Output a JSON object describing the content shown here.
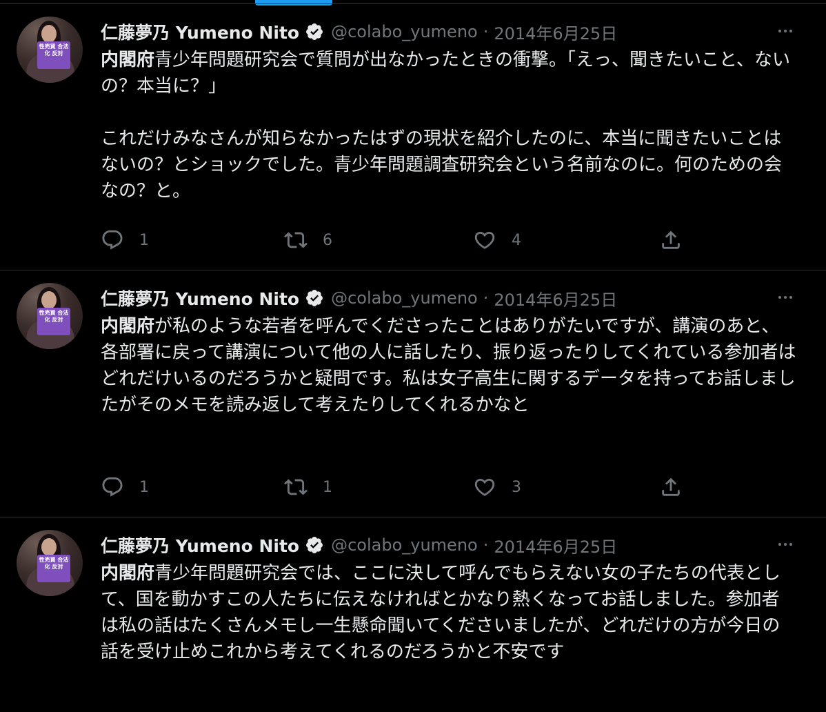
{
  "colors": {
    "background": "#000000",
    "text_primary": "#e7e9ea",
    "text_secondary": "#71767b",
    "divider": "#2f3336",
    "accent": "#1d9bf0",
    "avatar_sign": "#7e4fbd"
  },
  "tweets": [
    {
      "author": {
        "name": "仁藤夢乃 Yumeno Nito",
        "handle": "@colabo_yumeno",
        "verified_icon": "verified-badge-icon",
        "avatar_sign_text": "性売買 合法化 反対"
      },
      "separator": "·",
      "date": "2014年6月25日",
      "more_icon": "more-icon",
      "text": {
        "bold_prefix": "内閣府",
        "paragraph1_rest": "青少年問題研究会で質問が出なかったときの衝撃。「えっ、聞きたいこと、ないの？本当に？」",
        "paragraph2": "これだけみなさんが知らなかったはずの現状を紹介したのに、本当に聞きたいことはないの？とショックでした。青少年問題調査研究会という名前なのに。何のための会なの？と。"
      },
      "actions": {
        "reply_count": "1",
        "retweet_count": "6",
        "like_count": "4"
      }
    },
    {
      "author": {
        "name": "仁藤夢乃 Yumeno Nito",
        "handle": "@colabo_yumeno",
        "verified_icon": "verified-badge-icon",
        "avatar_sign_text": "性売買 合法化 反対"
      },
      "separator": "·",
      "date": "2014年6月25日",
      "more_icon": "more-icon",
      "text": {
        "bold_prefix": "内閣府",
        "paragraph1_rest": "が私のような若者を呼んでくださったことはありがたいですが、講演のあと、各部署に戻って講演について他の人に話したり、振り返ったりしてくれている参加者はどれだけいるのだろうかと疑問です。私は女子高生に関するデータを持ってお話しましたがそのメモを読み返して考えたりしてくれるかなと"
      },
      "actions": {
        "reply_count": "1",
        "retweet_count": "1",
        "like_count": "3"
      }
    },
    {
      "author": {
        "name": "仁藤夢乃 Yumeno Nito",
        "handle": "@colabo_yumeno",
        "verified_icon": "verified-badge-icon",
        "avatar_sign_text": "性売買 合法化 反対"
      },
      "separator": "·",
      "date": "2014年6月25日",
      "more_icon": "more-icon",
      "text": {
        "bold_prefix": "内閣府",
        "paragraph1_rest": "青少年問題研究会では、ここに決して呼んでもらえない女の子たちの代表として、国を動かすこの人たちに伝えなければとかなり熱くなってお話しました。参加者は私の話はたくさんメモし一生懸命聞いてくださいましたが、どれだけの方が今日の話を受け止めこれから考えてくれるのだろうかと不安です"
      }
    }
  ]
}
